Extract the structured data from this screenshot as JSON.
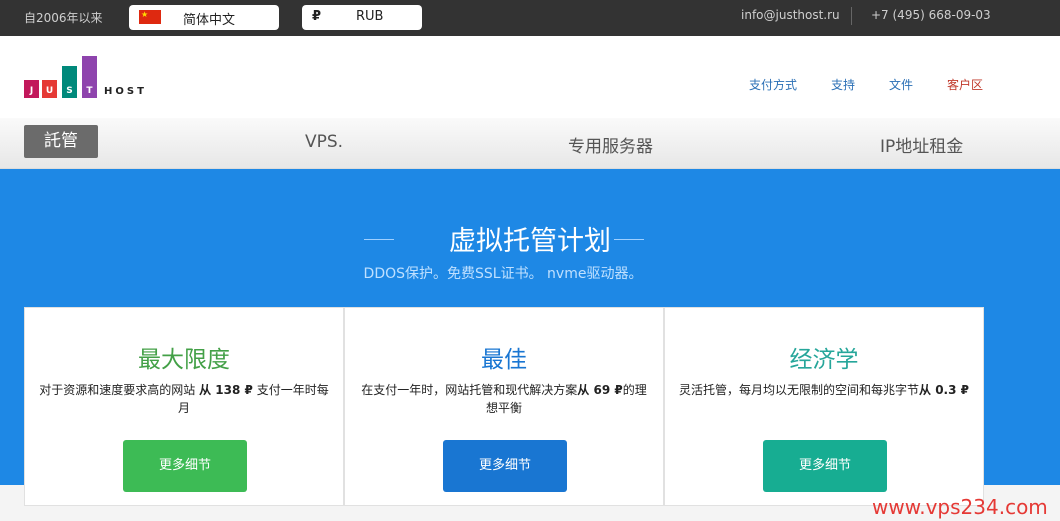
{
  "topbar": {
    "since": "自2006年以来",
    "language": "简体中文",
    "currency_symbol": "₽",
    "currency": "RUB",
    "email": "info@justhost.ru",
    "phone": "+7 (495) 668-09-03"
  },
  "logo": {
    "letters": [
      "J",
      "U",
      "S",
      "T"
    ],
    "host": "HOST",
    "colors": [
      "#c2185b",
      "#e53935",
      "#00897b",
      "#8e44ad"
    ]
  },
  "nav": {
    "payment": "支付方式",
    "support": "支持",
    "docs": "文件",
    "client_area": "客户区"
  },
  "menu": {
    "hosting": "託管",
    "vps": "VPS.",
    "dedicated": "专用服务器",
    "ip_rent": "IP地址租金"
  },
  "hero": {
    "title": "虚拟托管计划",
    "subtitle": "DDOS保护。免费SSL证书。 nvme驱动器。"
  },
  "plans": [
    {
      "title": "最大限度",
      "desc_pre": "对于资源和速度要求高的网站 ",
      "desc_bold": "从 138 ₽",
      "desc_post": " 支付一年时每月",
      "button": "更多细节",
      "title_color": "#43a047",
      "button_color": "#3dbb55"
    },
    {
      "title": "最佳",
      "desc_pre": "在支付一年时，网站托管和现代解决方案",
      "desc_bold": "从 69 ₽",
      "desc_post": "的理想平衡",
      "button": "更多细节",
      "title_color": "#1976d2",
      "button_color": "#1976d2"
    },
    {
      "title": "经济学",
      "desc_pre": "灵活托管，每月均以无限制的空间和每兆字节",
      "desc_bold": "从 0.3 ₽",
      "desc_post": "",
      "button": "更多细节",
      "title_color": "#26a69a",
      "button_color": "#17ad92"
    }
  ],
  "watermark": "www.vps234.com"
}
